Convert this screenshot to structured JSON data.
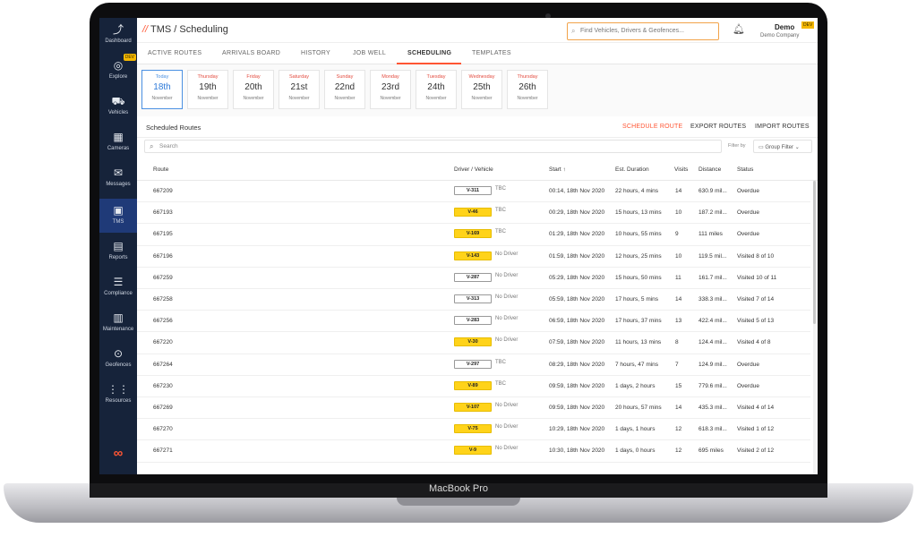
{
  "device": {
    "brand_label": "MacBook Pro"
  },
  "app": {
    "title_prefix": "TMS",
    "title_separator": "/",
    "title_page": "Scheduling",
    "search_placeholder": "Find Vehicles, Drivers & Geofences...",
    "user_name": "Demo",
    "user_company": "Demo Company",
    "env_tag": "DEV"
  },
  "sidebar": {
    "items": [
      {
        "label": "Dashboard",
        "icon": "chart-line-icon"
      },
      {
        "label": "Explore",
        "icon": "compass-icon",
        "tag": "DEV"
      },
      {
        "label": "Vehicles",
        "icon": "car-icon"
      },
      {
        "label": "Cameras",
        "icon": "camera-icon"
      },
      {
        "label": "Messages",
        "icon": "envelope-icon"
      },
      {
        "label": "TMS",
        "icon": "briefcase-icon",
        "active": true
      },
      {
        "label": "Reports",
        "icon": "document-icon"
      },
      {
        "label": "Compliance",
        "icon": "list-check-icon"
      },
      {
        "label": "Maintenance",
        "icon": "clipboard-icon"
      },
      {
        "label": "Geofences",
        "icon": "target-icon"
      },
      {
        "label": "Resources",
        "icon": "grid-icon"
      }
    ]
  },
  "tabs": [
    {
      "label": "ACTIVE ROUTES"
    },
    {
      "label": "ARRIVALS BOARD"
    },
    {
      "label": "HISTORY"
    },
    {
      "label": "JOB WELL"
    },
    {
      "label": "SCHEDULING",
      "active": true
    },
    {
      "label": "TEMPLATES"
    }
  ],
  "days": [
    {
      "name": "Today",
      "num": "18th",
      "month": "November",
      "today": true
    },
    {
      "name": "Thursday",
      "num": "19th",
      "month": "November"
    },
    {
      "name": "Friday",
      "num": "20th",
      "month": "November"
    },
    {
      "name": "Saturday",
      "num": "21st",
      "month": "November"
    },
    {
      "name": "Sunday",
      "num": "22nd",
      "month": "November"
    },
    {
      "name": "Monday",
      "num": "23rd",
      "month": "November"
    },
    {
      "name": "Tuesday",
      "num": "24th",
      "month": "November"
    },
    {
      "name": "Wednesday",
      "num": "25th",
      "month": "November"
    },
    {
      "name": "Thursday",
      "num": "26th",
      "month": "November"
    }
  ],
  "section": {
    "title": "Scheduled Routes",
    "schedule_route": "SCHEDULE ROUTE",
    "export_routes": "EXPORT ROUTES",
    "import_routes": "IMPORT ROUTES"
  },
  "filter": {
    "search_placeholder": "Search",
    "filter_by": "Filter by",
    "group_filter": "Group Filter"
  },
  "table": {
    "headers": {
      "route": "Route",
      "driver_vehicle": "Driver / Vehicle",
      "start": "Start ↑",
      "duration": "Est. Duration",
      "visits": "Visits",
      "distance": "Distance",
      "status": "Status"
    },
    "rows": [
      {
        "route": "667209",
        "vehicle": "V-311",
        "vehicle_color": "white",
        "driver": "TBC",
        "start": "00:14, 18th Nov 2020",
        "duration": "22 hours, 4 mins",
        "visits": "14",
        "distance": "630.9 mil...",
        "status": "Overdue"
      },
      {
        "route": "667193",
        "vehicle": "V-46",
        "vehicle_color": "yellow",
        "driver": "TBC",
        "start": "00:29, 18th Nov 2020",
        "duration": "15 hours, 13 mins",
        "visits": "10",
        "distance": "187.2 mil...",
        "status": "Overdue"
      },
      {
        "route": "667195",
        "vehicle": "V-169",
        "vehicle_color": "yellow",
        "driver": "TBC",
        "start": "01:29, 18th Nov 2020",
        "duration": "10 hours, 55 mins",
        "visits": "9",
        "distance": "111 miles",
        "status": "Overdue"
      },
      {
        "route": "667196",
        "vehicle": "V-143",
        "vehicle_color": "yellow",
        "driver": "No Driver",
        "start": "01:59, 18th Nov 2020",
        "duration": "12 hours, 25 mins",
        "visits": "10",
        "distance": "119.5 mil...",
        "status": "Visited 8 of 10"
      },
      {
        "route": "667259",
        "vehicle": "V-287",
        "vehicle_color": "white",
        "driver": "No Driver",
        "start": "05:29, 18th Nov 2020",
        "duration": "15 hours, 50 mins",
        "visits": "11",
        "distance": "161.7 mil...",
        "status": "Visited 10 of 11"
      },
      {
        "route": "667258",
        "vehicle": "V-313",
        "vehicle_color": "white",
        "driver": "No Driver",
        "start": "05:59, 18th Nov 2020",
        "duration": "17 hours, 5 mins",
        "visits": "14",
        "distance": "338.3 mil...",
        "status": "Visited 7 of 14"
      },
      {
        "route": "667256",
        "vehicle": "V-283",
        "vehicle_color": "white",
        "driver": "No Driver",
        "start": "06:59, 18th Nov 2020",
        "duration": "17 hours, 37 mins",
        "visits": "13",
        "distance": "422.4 mil...",
        "status": "Visited 5 of 13"
      },
      {
        "route": "667220",
        "vehicle": "V-30",
        "vehicle_color": "yellow",
        "driver": "No Driver",
        "start": "07:59, 18th Nov 2020",
        "duration": "11 hours, 13 mins",
        "visits": "8",
        "distance": "124.4 mil...",
        "status": "Visited 4 of 8"
      },
      {
        "route": "667264",
        "vehicle": "V-297",
        "vehicle_color": "white",
        "driver": "TBC",
        "start": "08:29, 18th Nov 2020",
        "duration": "7 hours, 47 mins",
        "visits": "7",
        "distance": "124.9 mil...",
        "status": "Overdue"
      },
      {
        "route": "667230",
        "vehicle": "V-89",
        "vehicle_color": "yellow",
        "driver": "TBC",
        "start": "09:59, 18th Nov 2020",
        "duration": "1 days, 2 hours",
        "visits": "15",
        "distance": "779.6 mil...",
        "status": "Overdue"
      },
      {
        "route": "667269",
        "vehicle": "V-107",
        "vehicle_color": "yellow",
        "driver": "No Driver",
        "start": "09:59, 18th Nov 2020",
        "duration": "20 hours, 57 mins",
        "visits": "14",
        "distance": "435.3 mil...",
        "status": "Visited 4 of 14"
      },
      {
        "route": "667270",
        "vehicle": "V-75",
        "vehicle_color": "yellow",
        "driver": "No Driver",
        "start": "10:29, 18th Nov 2020",
        "duration": "1 days, 1 hours",
        "visits": "12",
        "distance": "618.3 mil...",
        "status": "Visited 1 of 12"
      },
      {
        "route": "667271",
        "vehicle": "V-9",
        "vehicle_color": "yellow",
        "driver": "No Driver",
        "start": "10:30, 18th Nov 2020",
        "duration": "1 days, 0 hours",
        "visits": "12",
        "distance": "695 miles",
        "status": "Visited 2 of 12"
      }
    ]
  },
  "colors": {
    "accent": "#ff5533",
    "sidebar_bg": "#16233a",
    "sidebar_active": "#1f3a78",
    "vehicle_yellow": "#ffd31a",
    "today_blue": "#2f7bd9"
  }
}
